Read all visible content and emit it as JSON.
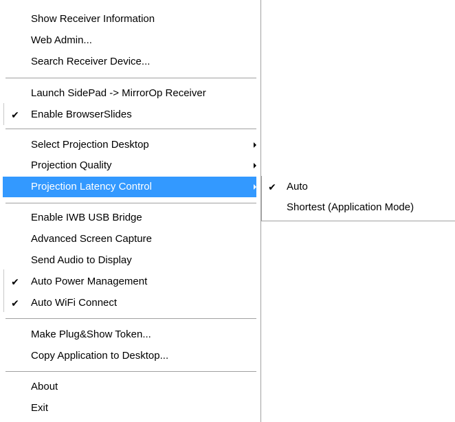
{
  "colors": {
    "highlight_bg": "#3399ff",
    "highlight_text": "#ffffff",
    "separator": "#a0a0a0",
    "text": "#000000"
  },
  "menu": {
    "items": [
      {
        "label": "Show Receiver Information",
        "checked": false,
        "has_submenu": false
      },
      {
        "label": "Web Admin...",
        "checked": false,
        "has_submenu": false
      },
      {
        "label": "Search Receiver Device...",
        "checked": false,
        "has_submenu": false
      },
      {
        "label": "Launch SidePad -> MirrorOp Receiver",
        "checked": false,
        "has_submenu": false
      },
      {
        "label": "Enable BrowserSlides",
        "checked": true,
        "has_submenu": false
      },
      {
        "label": "Select Projection Desktop",
        "checked": false,
        "has_submenu": true
      },
      {
        "label": "Projection Quality",
        "checked": false,
        "has_submenu": true
      },
      {
        "label": "Projection Latency Control",
        "checked": false,
        "has_submenu": true,
        "highlighted": true
      },
      {
        "label": "Enable IWB USB Bridge",
        "checked": false,
        "has_submenu": false
      },
      {
        "label": "Advanced Screen Capture",
        "checked": false,
        "has_submenu": false
      },
      {
        "label": "Send Audio to Display",
        "checked": false,
        "has_submenu": false
      },
      {
        "label": "Auto Power Management",
        "checked": true,
        "has_submenu": false
      },
      {
        "label": "Auto WiFi Connect",
        "checked": true,
        "has_submenu": false
      },
      {
        "label": "Make Plug&Show Token...",
        "checked": false,
        "has_submenu": false
      },
      {
        "label": "Copy Application to Desktop...",
        "checked": false,
        "has_submenu": false
      },
      {
        "label": "About",
        "checked": false,
        "has_submenu": false
      },
      {
        "label": "Exit",
        "checked": false,
        "has_submenu": false
      }
    ],
    "check_glyph": "✔"
  },
  "submenu": {
    "parent": "Projection Latency Control",
    "items": [
      {
        "label": "Auto",
        "checked": true
      },
      {
        "label": "Shortest (Application Mode)",
        "checked": false
      }
    ]
  }
}
